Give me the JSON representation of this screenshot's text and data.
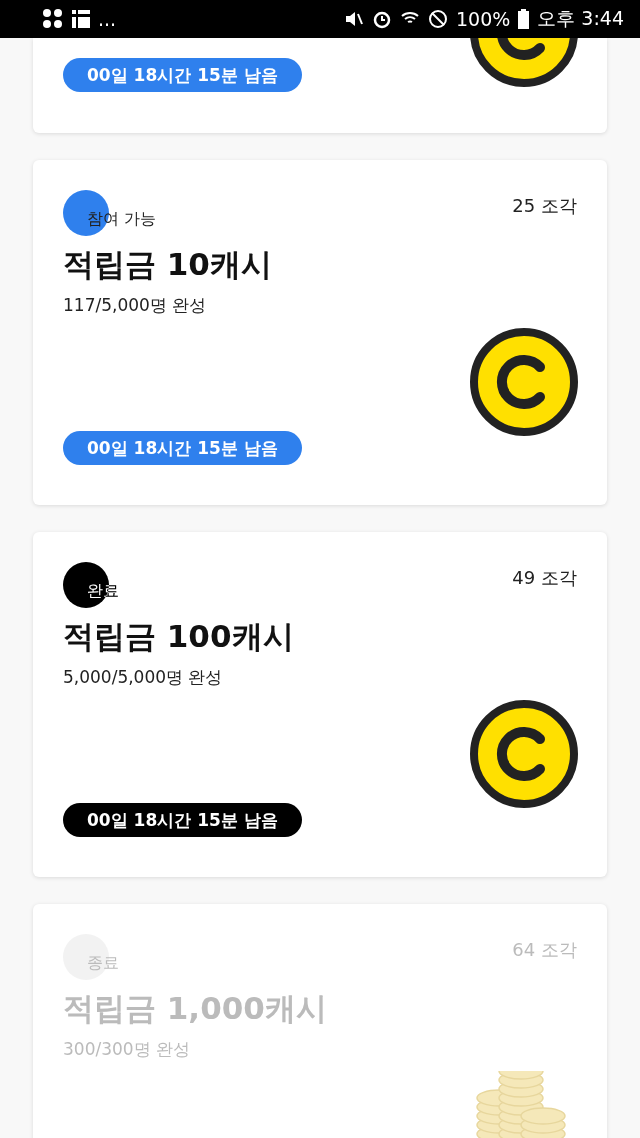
{
  "status_bar": {
    "more": "...",
    "battery": "100%",
    "time": "오후 3:44"
  },
  "cards": [
    {
      "kind": "available",
      "cut_off": true,
      "timer": "00일 18시간 15분 남음"
    },
    {
      "kind": "available",
      "cut_off": false,
      "badge": "참여 가능",
      "pieces": "25 조각",
      "title": "적립금 10캐시",
      "progress": "117/5,000명 완성",
      "timer": "00일 18시간 15분 남음"
    },
    {
      "kind": "done",
      "cut_off": false,
      "badge": "완료",
      "pieces": "49 조각",
      "title": "적립금 100캐시",
      "progress": "5,000/5,000명 완성",
      "timer": "00일 18시간 15분 남음"
    },
    {
      "kind": "ended",
      "cut_off": false,
      "badge": "종료",
      "pieces": "64 조각",
      "title": "적립금 1,000캐시",
      "progress": "300/300명 완성"
    }
  ]
}
